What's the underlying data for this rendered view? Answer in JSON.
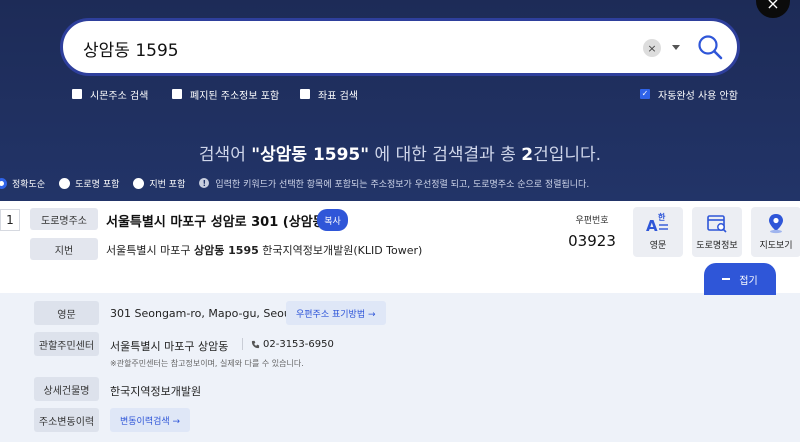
{
  "search": {
    "value": "상암동 1595",
    "clear_label": "×"
  },
  "close_label": "×",
  "options": [
    {
      "label": "시몬주소 검색",
      "checked": false
    },
    {
      "label": "폐지된 주소정보 포함",
      "checked": false
    },
    {
      "label": "좌표 검색",
      "checked": false
    },
    {
      "label": "자동완성 사용 안함",
      "checked": true
    }
  ],
  "summary": {
    "pre": "검색어 ",
    "query": "\"상암동 1595\"",
    "mid": " 에 대한 검색결과 총 ",
    "count": "2",
    "post": "건입니다."
  },
  "sort": {
    "items": [
      {
        "label": "정확도순",
        "selected": true
      },
      {
        "label": "도로명 포함",
        "selected": false
      },
      {
        "label": "지번 포함",
        "selected": false
      }
    ],
    "note": "입력한 키워드가 선택한 항목에 포함되는 주소정보가 우선정렬 되고, 도로명주소 순으로 정렬됩니다."
  },
  "result": {
    "index": "1",
    "road_tag": "도로명주소",
    "road_address": "서울특별시 마포구 성암로 301 (상암동)",
    "copy_label": "복사",
    "jibun_tag": "지번",
    "jibun_pre": "서울특별시 마포구 ",
    "jibun_bold": "상암동 1595",
    "jibun_post": " 한국지역정보개발원(KLID Tower)",
    "zip_label": "우편번호",
    "zip_code": "03923",
    "actions": {
      "english": "영문",
      "road_map": "도로명정보",
      "map": "지도보기"
    },
    "fold_label": "접기"
  },
  "detail": {
    "english_tag": "영문",
    "english_address": "301 Seongam-ro, Mapo-gu, Seoul",
    "english_btn": "우편주소 표기방법 →",
    "center_tag": "관할주민센터",
    "center_name": "서울특별시 마포구 상암동",
    "center_phone": "02-3153-6950",
    "center_note": "※관할주민센터는 참고정보이며, 실제와 다를 수 있습니다.",
    "building_tag": "상세건물명",
    "building_name": "한국지역정보개발원",
    "history_tag": "주소변동이력",
    "history_btn": "변동이력검색 →"
  },
  "colors": {
    "header_bg": "#1f2f5c",
    "accent": "#2f56d8",
    "detail_bg": "#eef2f9"
  }
}
